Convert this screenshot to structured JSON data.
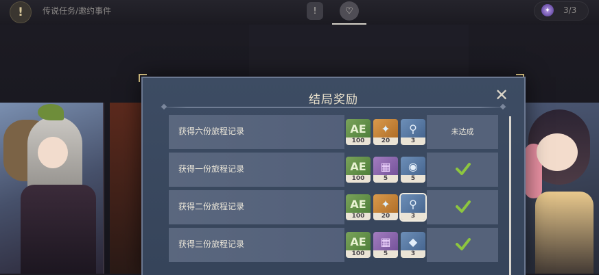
{
  "topbar": {
    "breadcrumb": "传说任务/邀约事件",
    "quest_icon": "!",
    "tabs": [
      {
        "name": "quest-book-icon",
        "glyph": "!",
        "active": false
      },
      {
        "name": "heart-book-icon",
        "glyph": "♡",
        "active": true
      }
    ],
    "counter": {
      "icon": "spark-icon",
      "text": "3/3"
    }
  },
  "modal": {
    "title": "结局奖励",
    "close_label": "✕",
    "rows": [
      {
        "label": "获得六份旅程记录",
        "items": [
          {
            "kind": "adventure-exp-icon",
            "color": "green",
            "glyph": "AE",
            "count": "100"
          },
          {
            "kind": "primogem-icon",
            "color": "orange",
            "glyph": "✦",
            "count": "20"
          },
          {
            "kind": "watering-can-icon",
            "color": "blue",
            "glyph": "⚲",
            "count": "3"
          }
        ],
        "status": "未达成",
        "completed": false
      },
      {
        "label": "获得一份旅程记录",
        "items": [
          {
            "kind": "adventure-exp-icon",
            "color": "green",
            "glyph": "AE",
            "count": "100"
          },
          {
            "kind": "purple-book-icon",
            "color": "purple",
            "glyph": "▦",
            "count": "5"
          },
          {
            "kind": "food-dish-icon",
            "color": "blue",
            "glyph": "◉",
            "count": "5"
          }
        ],
        "status": "",
        "completed": true
      },
      {
        "label": "获得二份旅程记录",
        "items": [
          {
            "kind": "adventure-exp-icon",
            "color": "green",
            "glyph": "AE",
            "count": "100"
          },
          {
            "kind": "primogem-icon",
            "color": "orange",
            "glyph": "✦",
            "count": "20"
          },
          {
            "kind": "watering-can-icon",
            "color": "blue",
            "glyph": "⚲",
            "count": "3",
            "selected": true
          }
        ],
        "status": "",
        "completed": true
      },
      {
        "label": "获得三份旅程记录",
        "items": [
          {
            "kind": "adventure-exp-icon",
            "color": "green",
            "glyph": "AE",
            "count": "100"
          },
          {
            "kind": "purple-book-icon",
            "color": "purple",
            "glyph": "▦",
            "count": "5"
          },
          {
            "kind": "red-crystal-icon",
            "color": "blue",
            "glyph": "◆",
            "count": "3"
          }
        ],
        "status": "",
        "completed": true
      }
    ]
  },
  "colors": {
    "accent_gold": "#e6cf8a",
    "check_green": "#8dc63f",
    "modal_bg": "#3d4c63"
  }
}
